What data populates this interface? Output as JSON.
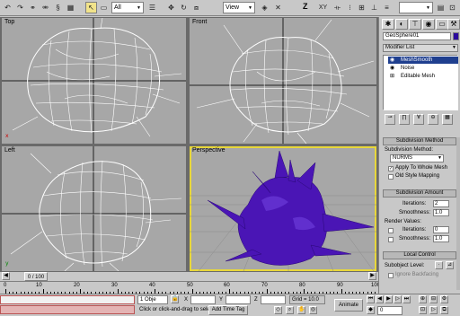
{
  "toolbar": {
    "selection_filter": "All",
    "ref_coord": "View",
    "named_selection": ""
  },
  "viewports": [
    {
      "key": "top",
      "label": "Top"
    },
    {
      "key": "front",
      "label": "Front"
    },
    {
      "key": "left",
      "label": "Left"
    },
    {
      "key": "perspective",
      "label": "Perspective"
    }
  ],
  "timeline": {
    "slider": "0 / 100",
    "ticks": [
      "0",
      "10",
      "20",
      "30",
      "40",
      "50",
      "60",
      "70",
      "80",
      "90",
      "100"
    ]
  },
  "status": {
    "selection_count": "1 Obje",
    "prompt": "Click or click-and-drag to selec",
    "add_time_tag": "Add Time Tag",
    "x_label": "X",
    "y_label": "Y",
    "z_label": "Z",
    "grid": "Grid = 10.0",
    "animate_label": "Animate",
    "frame": "0"
  },
  "command_panel": {
    "object_name": "GeoSphere01",
    "object_color": "#2a0a9c",
    "modifier_list": "Modifier List",
    "stack": [
      "MeshSmooth",
      "Noise",
      "Editable Mesh"
    ],
    "subdivision_method": {
      "title": "Subdivision Method",
      "label": "Subdivision Method:",
      "value": "NURMS",
      "apply_whole_mesh": "Apply To Whole Mesh",
      "old_style_mapping": "Old Style Mapping"
    },
    "subdivision_amount": {
      "title": "Subdivision Amount",
      "iterations_label": "Iterations:",
      "iterations_value": "2",
      "smoothness_label": "Smoothness:",
      "smoothness_value": "1.0",
      "render_values": "Render Values:",
      "render_iterations_label": "Iterations:",
      "render_iterations_value": "0",
      "render_smoothness_label": "Smoothness:",
      "render_smoothness_value": "1.0"
    },
    "local_control": {
      "title": "Local Control",
      "subobject_level": "Subobject Level:",
      "ignore_backfacing": "Ignore Backfacing"
    }
  },
  "colors": {
    "mesh_purple": "#4a15b5",
    "viewport_bg": "#a7a7a7",
    "active_border": "#e8d73a",
    "selection_blue": "#1f3f8f"
  }
}
